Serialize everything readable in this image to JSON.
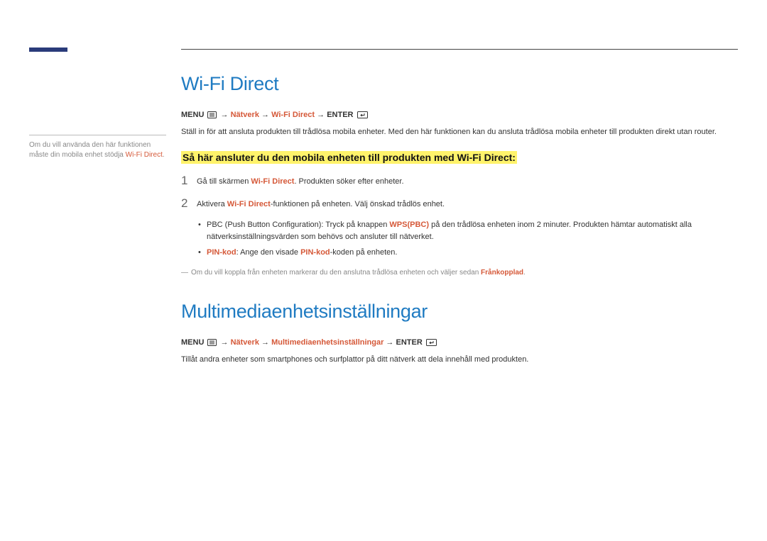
{
  "sidebar": {
    "note_pre": "Om du vill använda den här funktionen måste din mobila enhet stödja ",
    "note_red": "Wi-Fi Direct",
    "note_post": "."
  },
  "sec1": {
    "heading": "Wi-Fi Direct",
    "menu_label": "MENU",
    "path_natverk": "Nätverk",
    "path_wifidirect": "Wi-Fi Direct",
    "enter_label": "ENTER",
    "arrow": " → ",
    "intro": "Ställ in för att ansluta produkten till trådlösa mobila enheter. Med den här funktionen kan du ansluta trådlösa mobila enheter till produkten direkt utan router.",
    "subhead": "Så här ansluter du den mobila enheten till produkten med Wi-Fi Direct:",
    "step1_num": "1",
    "step1_pre": "Gå till skärmen ",
    "step1_red": "Wi-Fi Direct",
    "step1_post": ". Produkten söker efter enheter.",
    "step2_num": "2",
    "step2_pre": "Aktivera ",
    "step2_red": "Wi-Fi Direct",
    "step2_post": "-funktionen på enheten. Välj önskad trådlös enhet.",
    "bullet1_pre": "PBC (Push Button Configuration): Tryck på knappen ",
    "bullet1_red": "WPS(PBC)",
    "bullet1_post": " på den trådlösa enheten inom 2 minuter. Produkten hämtar automatiskt alla nätverksinställningsvärden som behövs och ansluter till nätverket.",
    "bullet2_red1": "PIN-kod",
    "bullet2_mid": ": Ange den visade ",
    "bullet2_red2": "PIN-kod",
    "bullet2_post": "-koden på enheten.",
    "footnote_pre": "Om du vill koppla från enheten markerar du den anslutna trådlösa enheten och väljer sedan ",
    "footnote_red": "Frånkopplad",
    "footnote_post": "."
  },
  "sec2": {
    "heading": "Multimediaenhetsinställningar",
    "menu_label": "MENU",
    "path_natverk": "Nätverk",
    "path_multi": "Multimediaenhetsinställningar",
    "enter_label": "ENTER",
    "arrow": " → ",
    "intro": "Tillåt andra enheter som smartphones och surfplattor på ditt nätverk att dela innehåll med produkten."
  }
}
